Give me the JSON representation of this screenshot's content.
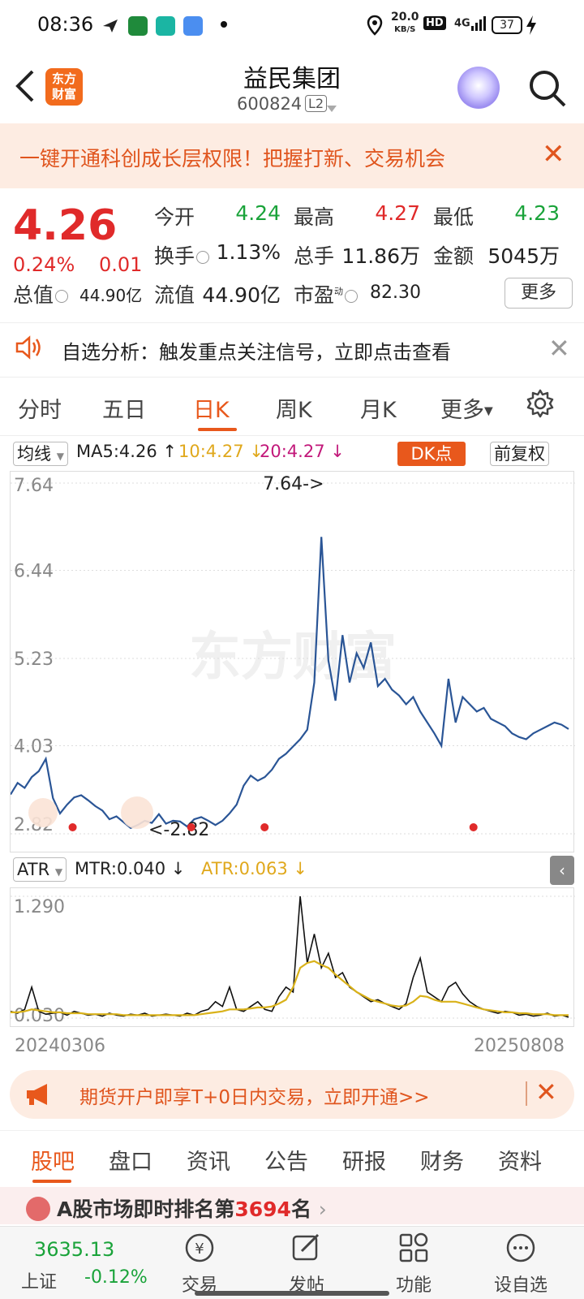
{
  "status_bar": {
    "time": "08:36",
    "net_speed": "20.0",
    "net_unit": "KB/S",
    "hd": "HD",
    "signal": "4G",
    "battery": "37"
  },
  "header": {
    "logo_line1": "东方",
    "logo_line2": "财富",
    "stock_name": "益民集团",
    "stock_code": "600824",
    "level": "L2"
  },
  "banner": {
    "text": "一键开通科创成长层权限！把握打新、交易机会"
  },
  "quote": {
    "price": "4.26",
    "change_pct": "0.24%",
    "change": "0.01",
    "open_label": "今开",
    "open": "4.24",
    "high_label": "最高",
    "high": "4.27",
    "low_label": "最低",
    "low": "4.23",
    "turnover_label": "换手",
    "turnover": "1.13%",
    "volume_label": "总手",
    "volume": "11.86万",
    "amount_label": "金额",
    "amount": "5045万",
    "mcap_label": "总值",
    "mcap": "44.90亿",
    "float_label": "流值",
    "float": "44.90亿",
    "pe_label": "市盈",
    "pe_sup": "动",
    "pe": "82.30",
    "more": "更多"
  },
  "notice": {
    "text": "自选分析：触发重点关注信号，立即点击查看"
  },
  "k_tabs": [
    "分时",
    "五日",
    "日K",
    "周K",
    "月K",
    "更多"
  ],
  "ma_row": {
    "selector": "均线",
    "ma5": "MA5:4.26",
    "ma10": "10:4.27",
    "ma20": "20:4.27",
    "dk": "DK点",
    "adjust": "前复权"
  },
  "atr_row": {
    "selector": "ATR",
    "mtr": "MTR:0.040",
    "atr": "ATR:0.063"
  },
  "colors": {
    "accent": "#e8581c",
    "up": "#e02a2a",
    "down": "#1aa33a",
    "price_line": "#2a5596",
    "atr_line": "#d9b21a",
    "ma10": "#e0a81c",
    "ma20": "#c2187a"
  },
  "chart_data": [
    {
      "type": "line",
      "title": "",
      "y_ticks": [
        "7.64",
        "6.44",
        "5.23",
        "4.03",
        "2.82"
      ],
      "ylim": [
        2.82,
        7.64
      ],
      "max_label": "7.64->",
      "min_label": "<-2.82",
      "x_start": "20240306",
      "x_end": "20250808",
      "watermark": "东方财富",
      "series": [
        {
          "values": [
            3.36,
            3.52,
            3.45,
            3.6,
            3.68,
            3.85,
            3.31,
            3.1,
            3.22,
            3.32,
            3.35,
            3.28,
            3.2,
            3.14,
            3.02,
            3.06,
            2.98,
            2.9,
            2.94,
            3.0,
            2.97,
            3.09,
            2.96,
            3.0,
            2.99,
            2.92,
            3.02,
            3.05,
            3.0,
            2.94,
            3.0,
            3.1,
            3.22,
            3.48,
            3.62,
            3.55,
            3.6,
            3.7,
            3.85,
            3.92,
            4.02,
            4.12,
            4.25,
            4.9,
            6.9,
            5.2,
            4.65,
            5.55,
            4.9,
            5.3,
            5.1,
            5.45,
            4.85,
            4.95,
            4.8,
            4.72,
            4.6,
            4.7,
            4.5,
            4.35,
            4.2,
            4.03,
            4.95,
            4.35,
            4.7,
            4.6,
            4.5,
            4.55,
            4.4,
            4.35,
            4.3,
            4.2,
            4.15,
            4.12,
            4.2,
            4.25,
            4.3,
            4.35,
            4.32,
            4.26
          ]
        }
      ]
    },
    {
      "type": "line",
      "title": "",
      "y_ticks": [
        "1.290",
        "0.030"
      ],
      "ylim": [
        0.03,
        1.29
      ],
      "series": [
        {
          "name": "MTR",
          "values": [
            0.1,
            0.08,
            0.12,
            0.35,
            0.1,
            0.07,
            0.08,
            0.09,
            0.06,
            0.1,
            0.08,
            0.06,
            0.07,
            0.05,
            0.08,
            0.06,
            0.05,
            0.07,
            0.06,
            0.08,
            0.05,
            0.06,
            0.07,
            0.06,
            0.05,
            0.08,
            0.06,
            0.1,
            0.12,
            0.2,
            0.15,
            0.35,
            0.12,
            0.1,
            0.15,
            0.2,
            0.12,
            0.1,
            0.25,
            0.35,
            0.3,
            1.29,
            0.6,
            0.9,
            0.55,
            0.7,
            0.45,
            0.5,
            0.35,
            0.3,
            0.25,
            0.2,
            0.22,
            0.18,
            0.15,
            0.12,
            0.18,
            0.45,
            0.65,
            0.3,
            0.25,
            0.2,
            0.35,
            0.4,
            0.28,
            0.2,
            0.15,
            0.12,
            0.1,
            0.08,
            0.1,
            0.09,
            0.06,
            0.07,
            0.05,
            0.06,
            0.08,
            0.05,
            0.06,
            0.04
          ]
        },
        {
          "name": "ATR",
          "values": [
            0.09,
            0.09,
            0.1,
            0.12,
            0.11,
            0.1,
            0.09,
            0.09,
            0.08,
            0.08,
            0.08,
            0.07,
            0.07,
            0.07,
            0.07,
            0.07,
            0.06,
            0.06,
            0.06,
            0.06,
            0.06,
            0.06,
            0.06,
            0.06,
            0.06,
            0.06,
            0.06,
            0.07,
            0.08,
            0.09,
            0.1,
            0.12,
            0.12,
            0.12,
            0.13,
            0.14,
            0.14,
            0.15,
            0.18,
            0.22,
            0.35,
            0.55,
            0.6,
            0.62,
            0.58,
            0.55,
            0.48,
            0.42,
            0.36,
            0.3,
            0.26,
            0.22,
            0.2,
            0.18,
            0.16,
            0.15,
            0.16,
            0.2,
            0.26,
            0.25,
            0.22,
            0.2,
            0.2,
            0.2,
            0.18,
            0.16,
            0.14,
            0.12,
            0.11,
            0.1,
            0.09,
            0.09,
            0.08,
            0.08,
            0.07,
            0.07,
            0.07,
            0.06,
            0.06,
            0.06
          ]
        }
      ]
    }
  ],
  "ad2": {
    "text": "期货开户即享T+0日内交易，立即开通>>"
  },
  "bottom_tabs": [
    "股吧",
    "盘口",
    "资讯",
    "公告",
    "研报",
    "财务",
    "资料"
  ],
  "rank": {
    "prefix": "A股市场即时排名第",
    "num": "3694",
    "suffix": "名"
  },
  "bottom_nav": {
    "index_value": "3635.13",
    "index_name": "上证",
    "index_change": "-0.12%",
    "items": [
      "交易",
      "发帖",
      "功能",
      "设自选"
    ]
  }
}
